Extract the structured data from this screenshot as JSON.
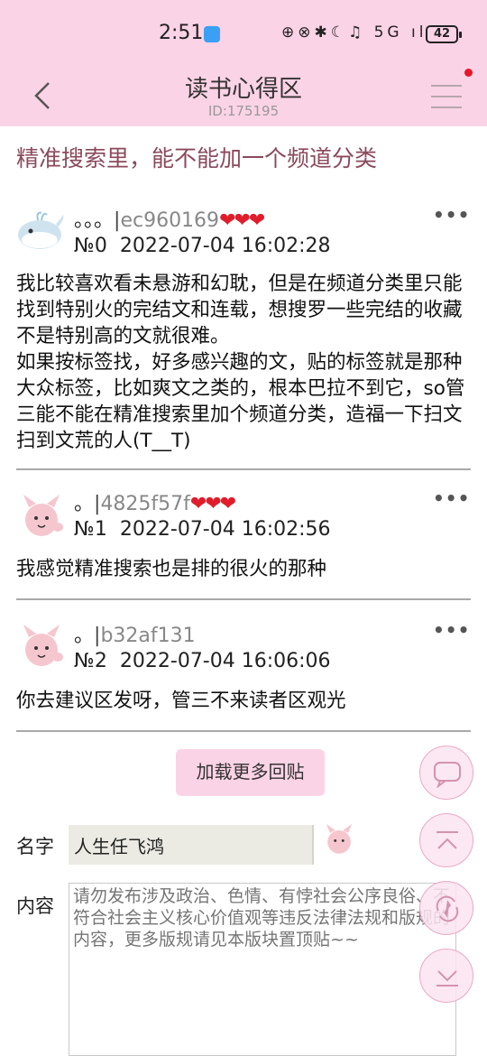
{
  "status_bar": {
    "time": "2:51",
    "icons": "⊕⊗✱☾♫ 5G ıl",
    "battery": "42"
  },
  "header": {
    "title": "读书心得区",
    "id_text": "ID:175195"
  },
  "thread": {
    "title": "精准搜索里，能不能加一个频道分类"
  },
  "posts": [
    {
      "dots": "。。。",
      "author_id": "ec960169",
      "hearts": "❤❤❤",
      "floor": "№0",
      "time": "2022-07-04 16:02:28",
      "body": "我比较喜欢看未悬游和幻耽，但是在频道分类里只能找到特别火的完结文和连载，想搜罗一些完结的收藏不是特别高的文就很难。\n如果按标签找，好多感兴趣的文，贴的标签就是那种大众标签，比如爽文之类的，根本巴拉不到它，so管三能不能在精准搜索里加个频道分类，造福一下扫文扫到文荒的人(T__T)",
      "more": "•••"
    },
    {
      "dots": "。",
      "author_id": "4825f57f",
      "hearts": "❤❤❤",
      "floor": "№1",
      "time": "2022-07-04 16:02:56",
      "body": "我感觉精准搜索也是排的很火的那种",
      "more": "•••"
    },
    {
      "dots": "。",
      "author_id": "b32af131",
      "hearts": "",
      "floor": "№2",
      "time": "2022-07-04 16:06:06",
      "body": "你去建议区发呀，管三不来读者区观光",
      "more": "•••"
    }
  ],
  "load_more_label": "加载更多回贴",
  "form": {
    "name_label": "名字",
    "name_value": "人生任飞鸿",
    "content_label": "内容",
    "content_placeholder": "请勿发布涉及政治、色情、有悖社会公序良俗、不符合社会主义核心价值观等违反法律法规和版规的内容，更多版规请见本版块置顶贴~~"
  },
  "colors": {
    "header_bg": "#fbd3e6",
    "title_color": "#8a4a5c",
    "heart": "#e01e2b"
  },
  "icons": {
    "back": "chevron-left-icon",
    "menu": "hamburger-menu-icon",
    "fab_chat": "chat-icon",
    "fab_top": "arrow-up-icon",
    "fab_refresh": "refresh-icon",
    "fab_bottom": "arrow-down-icon"
  }
}
